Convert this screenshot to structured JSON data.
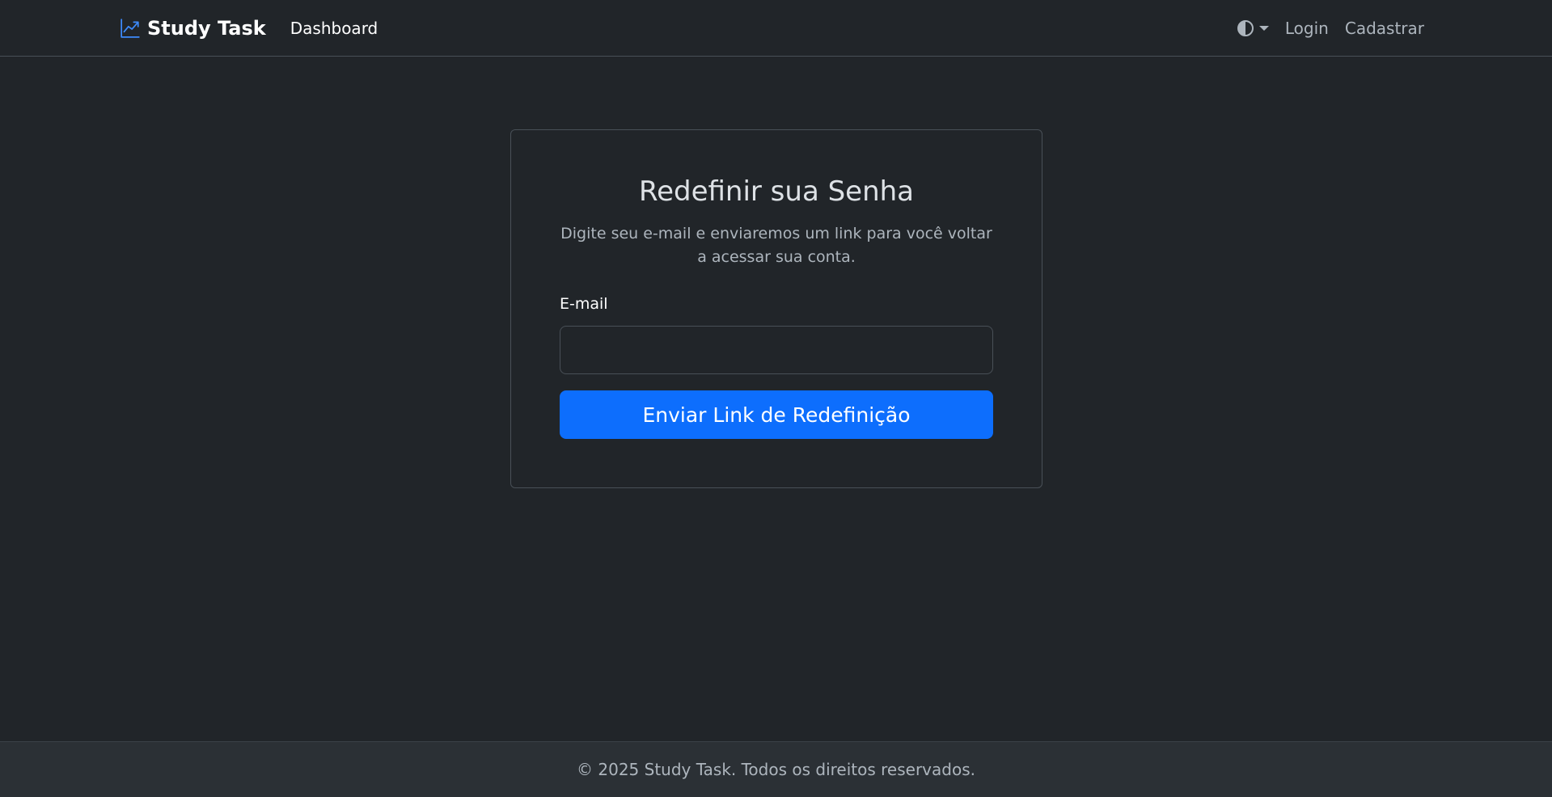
{
  "navbar": {
    "brand": "Study Task",
    "brand_icon": "trending-up-icon",
    "links": [
      {
        "label": "Dashboard"
      }
    ],
    "theme_toggle_icon": "contrast-icon",
    "right_links": [
      {
        "label": "Login"
      },
      {
        "label": "Cadastrar"
      }
    ]
  },
  "card": {
    "title": "Redefinir sua Senha",
    "subtitle": "Digite seu e-mail e enviaremos um link para você voltar a acessar sua conta.",
    "email_label": "E-mail",
    "email_value": "",
    "email_placeholder": "",
    "submit_label": "Enviar Link de Redefinição"
  },
  "footer": {
    "text": "© 2025 Study Task. Todos os direitos reservados."
  },
  "colors": {
    "background": "#212529",
    "accent": "#0d6efd",
    "footer_bg": "#2b3035"
  }
}
